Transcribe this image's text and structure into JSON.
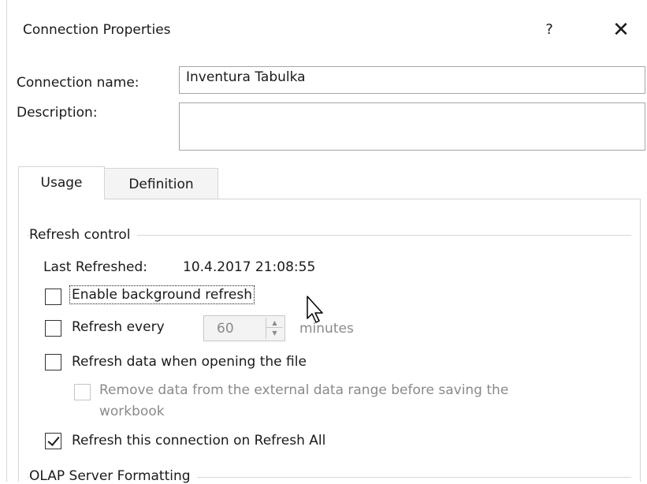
{
  "window": {
    "title": "Connection Properties",
    "help_label": "?",
    "close_label": "✕"
  },
  "fields": {
    "name_label": "Connection name:",
    "name_value": "Inventura Tabulka",
    "description_label": "Description:",
    "description_value": ""
  },
  "tabs": [
    {
      "label": "Usage",
      "active": true
    },
    {
      "label": "Definition",
      "active": false
    }
  ],
  "refresh_control": {
    "group_title": "Refresh control",
    "last_refreshed_label": "Last Refreshed:",
    "last_refreshed_value": "10.4.2017  21:08:55",
    "enable_background": {
      "label": "Enable background refresh",
      "checked": false
    },
    "refresh_every": {
      "label": "Refresh every",
      "checked": false,
      "value": "60",
      "unit": "minutes"
    },
    "refresh_on_open": {
      "label": "Refresh data when opening the file",
      "checked": false
    },
    "remove_data": {
      "label_line1": "Remove data from the external data range before saving the",
      "label_line2": "workbook",
      "checked": false,
      "enabled": false
    },
    "refresh_all": {
      "label": "Refresh this connection on Refresh All",
      "checked": true
    }
  },
  "olap": {
    "group_title": "OLAP Server Formatting"
  },
  "colors": {
    "accent_border": "#a5a5a5",
    "disabled_text": "#8a8a8a"
  }
}
